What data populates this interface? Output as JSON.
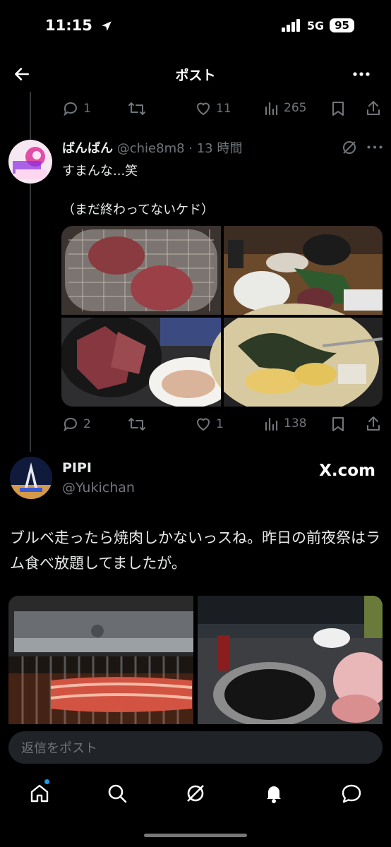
{
  "status_bar": {
    "time": "11:15",
    "network": "5G",
    "battery": "95"
  },
  "header": {
    "title": "ポスト"
  },
  "prev_tweet_actions": {
    "replies": "1",
    "likes": "11",
    "views": "265"
  },
  "tweet": {
    "display_name": "ばんばん",
    "handle": "@chie8m8",
    "time": "13 時間",
    "text_line1": "すまんな...笑",
    "text_line2": "（まだ終わってないケド）",
    "replies": "2",
    "likes": "1",
    "views": "138"
  },
  "card": {
    "display_name": "PIPI",
    "handle": "@Yukichan",
    "brand": "X.com",
    "text": "ブルベ走ったら焼肉しかないっスね。昨日の前夜祭はラム食べ放題してましたが。"
  },
  "reply": {
    "placeholder": "返信をポスト"
  },
  "colors": {
    "accent": "#1d9bf0",
    "background": "#000000",
    "muted": "#71767b"
  },
  "icons": [
    "back-arrow-icon",
    "more-icon",
    "reply-icon",
    "retweet-icon",
    "like-icon",
    "views-icon",
    "bookmark-icon",
    "share-icon",
    "grok-icon",
    "home-icon",
    "search-icon",
    "bell-icon",
    "messages-icon"
  ]
}
